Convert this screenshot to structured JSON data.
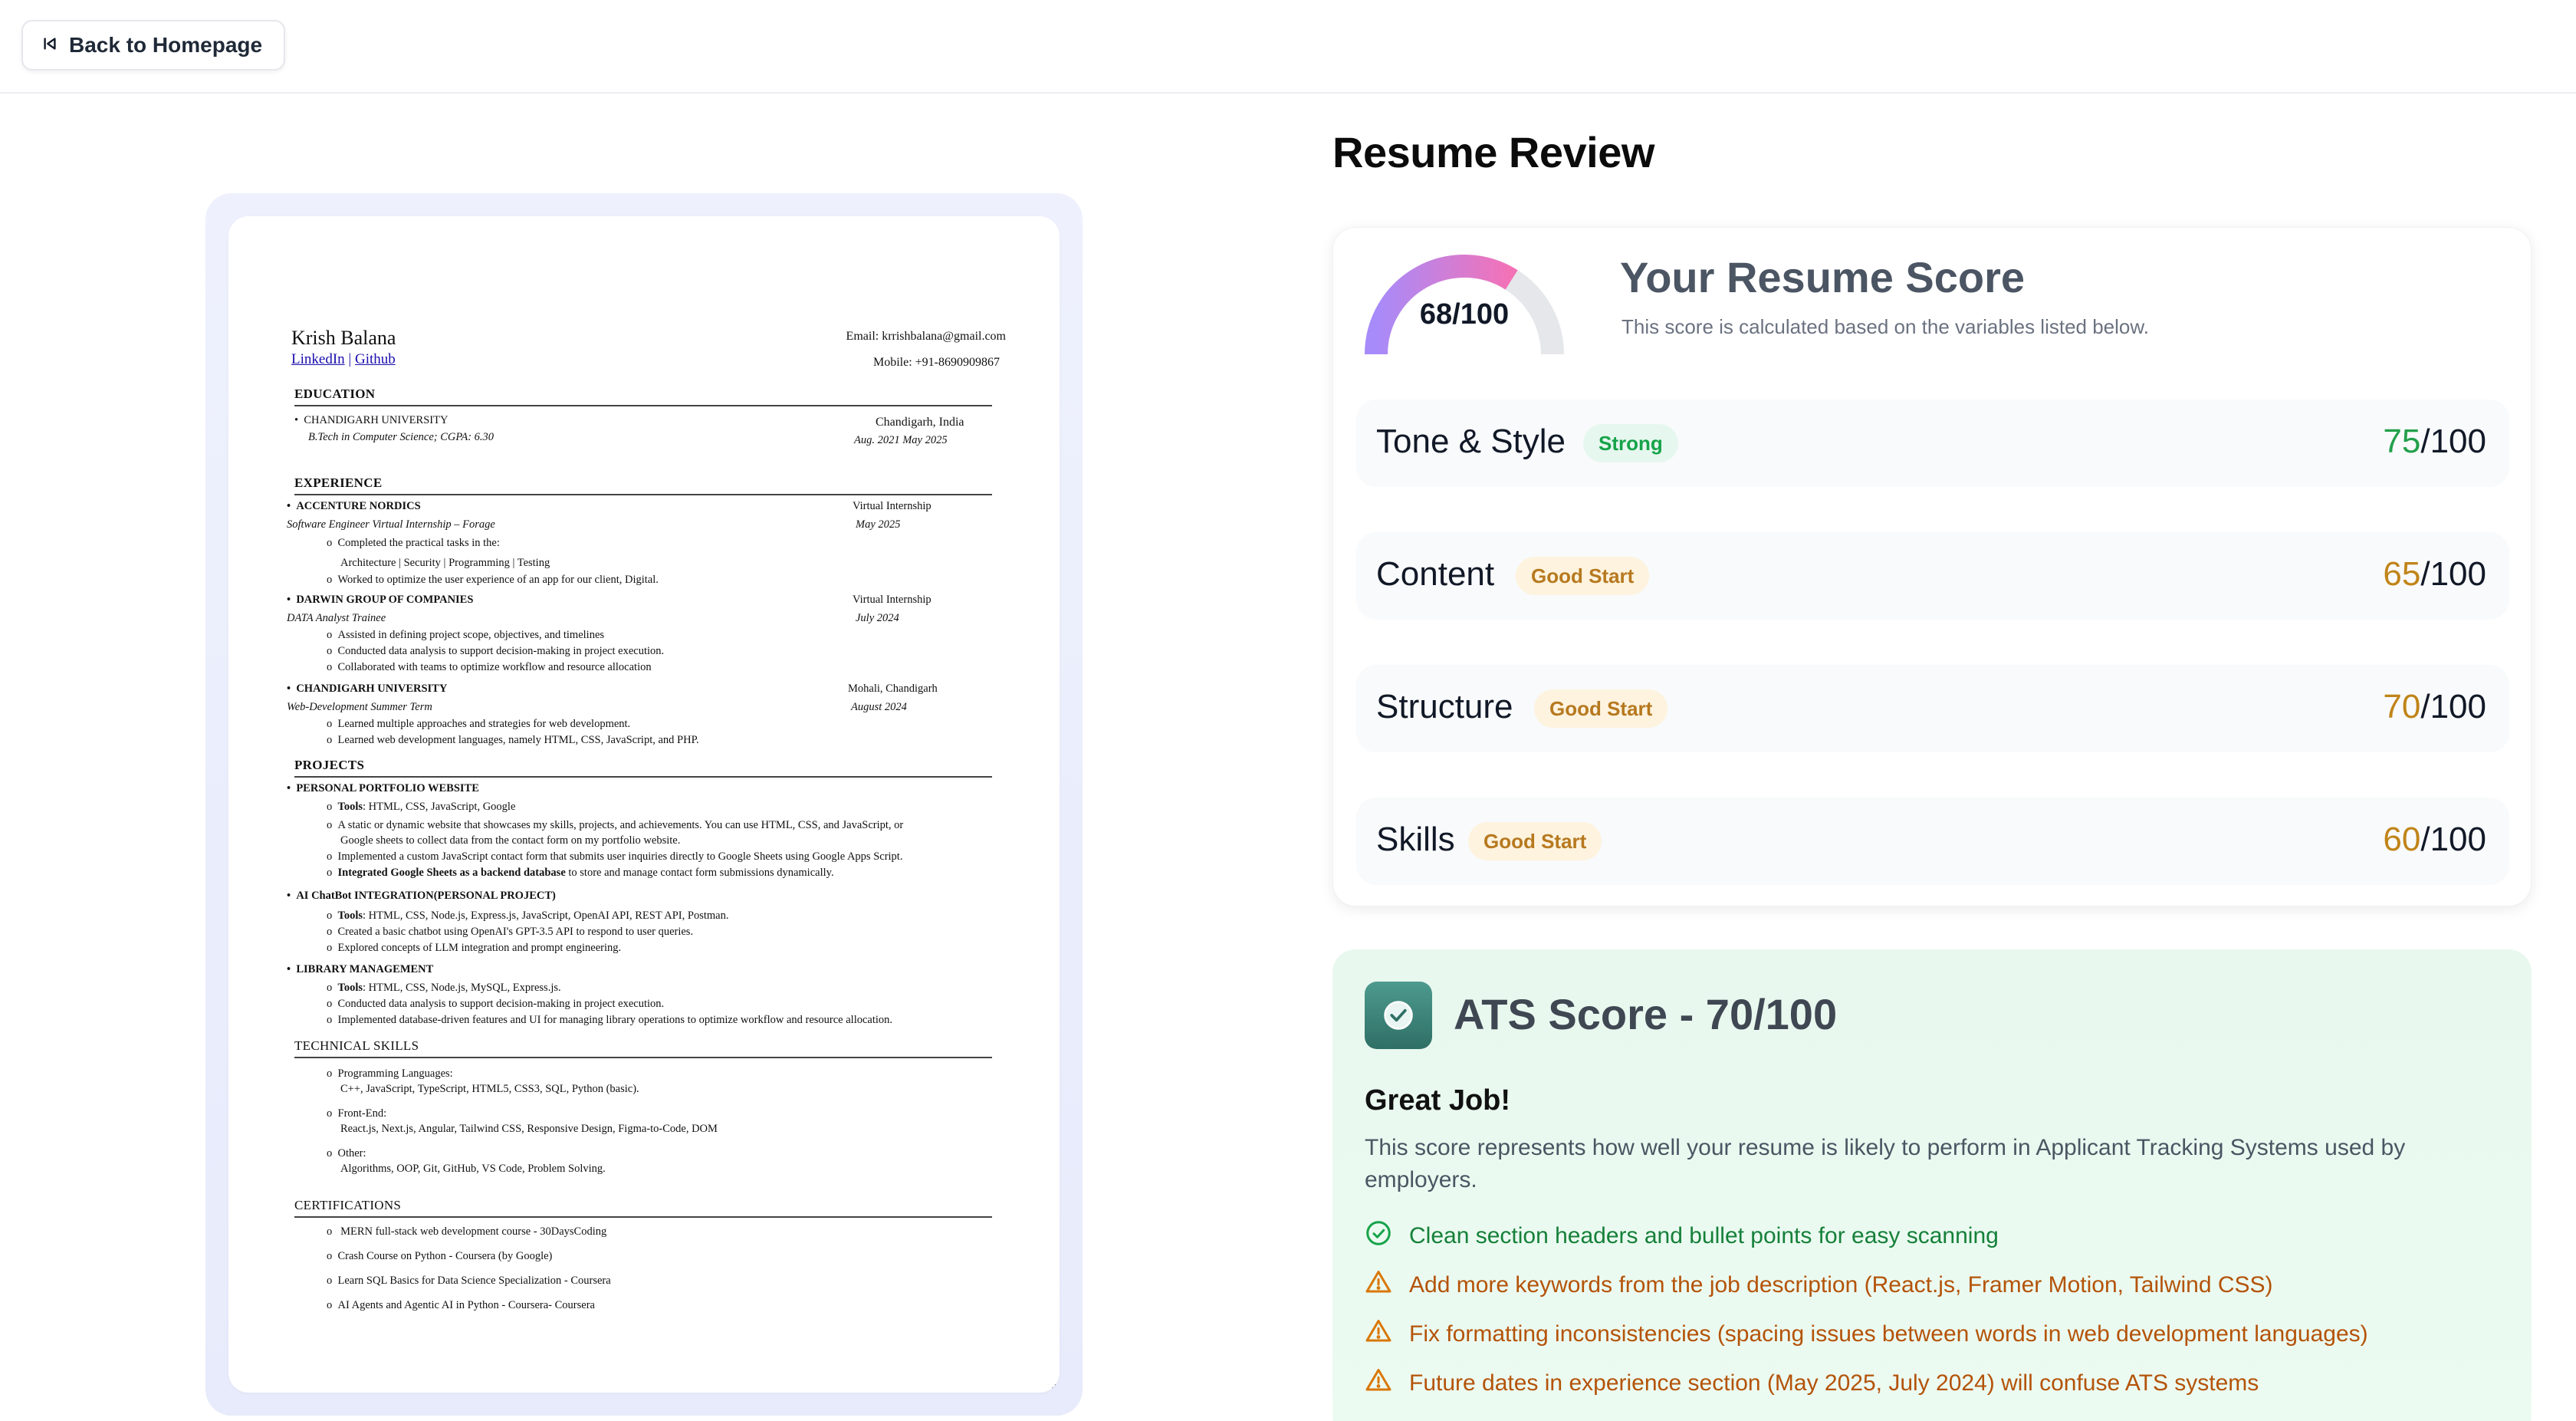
{
  "nav": {
    "back_label": "Back to Homepage"
  },
  "resume": {
    "name": "Krish Balana",
    "links": [
      "LinkedIn",
      "Github"
    ],
    "link_sep": "|",
    "email": "Email:  krrishbalana@gmail.com",
    "mobile": "Mobile:  +91-8690909867",
    "education_header": "EDUCATION",
    "edu_school": "CHANDIGARH UNIVERSITY",
    "edu_degree": "B.Tech  in  Computer  Science;  CGPA:  6.30",
    "edu_location": "Chandigarh,  India",
    "edu_dates": "Aug.  2021     May  2025",
    "experience_header": "EXPERIENCE",
    "exp1_company": "ACCENTURE NORDICS",
    "exp1_role": "Software Engineer Virtual Internship – Forage",
    "exp1_type": "Virtual Internship",
    "exp1_date": "May 2025",
    "exp1_b1": "Completed the practical tasks in the:",
    "exp1_b1b": "Architecture | Security | Programming | Testing",
    "exp1_b2": "Worked to optimize the user experience of an app for our client, Digital.",
    "exp2_company": "DARWIN GROUP OF COMPANIES",
    "exp2_role": "DATA Analyst Trainee",
    "exp2_type": "Virtual Internship",
    "exp2_date": "July 2024",
    "exp2_b1": "Assisted in defining project scope, objectives, and timelines",
    "exp2_b2": "Conducted data analysis to support decision-making in project execution.",
    "exp2_b3": "Collaborated with teams to optimize workflow and resource allocation",
    "exp3_company": "CHANDIGARH UNIVERSITY",
    "exp3_role": "Web-Development Summer Term",
    "exp3_loc": "Mohali, Chandigarh",
    "exp3_date": "August 2024",
    "exp3_b1": "Learned multiple approaches and strategies for web development.",
    "exp3_b2": "Learned web development languages, namely HTML, CSS, JavaScript, and PHP.",
    "projects_header": "PROJECTS",
    "proj1_title": "PERSONAL PORTFOLIO WEBSITE",
    "proj1_tools_label": "Tools",
    "proj1_tools": ": HTML, CSS, JavaScript, Google",
    "proj1_b2": "A static or dynamic website that showcases my skills, projects, and achievements. You can use HTML, CSS, and JavaScript, or",
    "proj1_b2b": "Google sheets to collect data from the contact form on my portfolio website.",
    "proj1_b3": "Implemented a custom JavaScript contact form that submits user inquiries directly to Google Sheets using Google Apps Script.",
    "proj1_b4_bold": "Integrated Google Sheets as a backend database",
    "proj1_b4_rest": " to store and manage contact form submissions dynamically.",
    "proj2_title": "AI ChatBot INTEGRATION(PERSONAL PROJECT)",
    "proj2_tools_label": "Tools",
    "proj2_tools": ": HTML, CSS, Node.js,  Express.js, JavaScript, OpenAI API, REST API, Postman.",
    "proj2_b2": "Created a basic chatbot using OpenAI's GPT-3.5 API to respond to user queries.",
    "proj2_b3": "Explored concepts of LLM integration and prompt engineering.",
    "proj3_title": "LIBRARY MANAGEMENT",
    "proj3_tools_label": "Tools",
    "proj3_tools": ": HTML, CSS, Node.js, MySQL, Express.js.",
    "proj3_b2": "Conducted data analysis to support decision-making in project execution.",
    "proj3_b3": "Implemented database-driven features and UI for managing library operations to optimize workflow and resource allocation.",
    "skills_header": "TECHNICAL SKILLS",
    "sk1_label": "Programming Languages:",
    "sk1_val": "C++, JavaScript, TypeScript, HTML5, CSS3, SQL, Python (basic).",
    "sk2_label": "Front-End:",
    "sk2_val": "React.js, Next.js, Angular, Tailwind CSS, Responsive Design, Figma-to-Code, DOM",
    "sk3_label": "Other:",
    "sk3_val": "Algorithms, OOP, Git, GitHub, VS Code, Problem Solving.",
    "cert_header": "CERTIFICATIONS",
    "cert1": " MERN full-stack web development course - 30DaysCoding",
    "cert2": "Crash Course on Python - Coursera (by Google)",
    "cert3": "Learn SQL Basics for Data Science Specialization - Coursera",
    "cert4": "AI Agents and Agentic AI in Python - Coursera- Coursera"
  },
  "review": {
    "title": "Resume Review",
    "overall": {
      "score": 68,
      "max": 100,
      "label": "68/100",
      "heading": "Your Resume Score",
      "subtext": "This score is calculated based on the variables listed below."
    },
    "categories": [
      {
        "name": "Tone & Style",
        "badge": "Strong",
        "score": "75",
        "max": "/100"
      },
      {
        "name": "Content",
        "badge": "Good Start",
        "score": "65",
        "max": "/100"
      },
      {
        "name": "Structure",
        "badge": "Good Start",
        "score": "70",
        "max": "/100"
      },
      {
        "name": "Skills",
        "badge": "Good Start",
        "score": "60",
        "max": "/100"
      }
    ]
  },
  "ats": {
    "title": "ATS Score - 70/100",
    "headline": "Great Job!",
    "description": "This score represents how well your resume is likely to perform in Applicant Tracking Systems used by employers.",
    "tips": [
      {
        "type": "good",
        "icon": "check-circle-icon",
        "text": "Clean section headers and bullet points for easy scanning"
      },
      {
        "type": "improve",
        "icon": "warning-icon",
        "text": "Add more keywords from the job description (React.js, Framer Motion, Tailwind CSS)"
      },
      {
        "type": "improve",
        "icon": "warning-icon",
        "text": "Fix formatting inconsistencies (spacing issues between words in web development languages)"
      },
      {
        "type": "improve",
        "icon": "warning-icon",
        "text": "Future dates in experience section (May 2025, July 2024) will confuse ATS systems"
      }
    ]
  },
  "colors": {
    "strong": "#16a34a",
    "good": "#c08418",
    "gauge_start": "#a78bfa",
    "gauge_end": "#f472b6",
    "gauge_track": "#e5e7eb"
  }
}
